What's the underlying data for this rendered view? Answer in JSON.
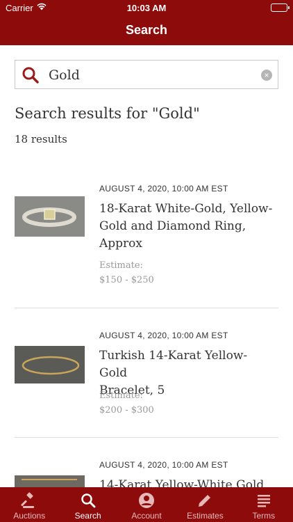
{
  "status_bar": {
    "carrier": "Carrier",
    "time": "10:03 AM"
  },
  "nav": {
    "title": "Search"
  },
  "search": {
    "value": "Gold",
    "clear_icon": "×"
  },
  "results": {
    "heading": "Search results for \"Gold\"",
    "count": "18 results",
    "items": [
      {
        "date": "AUGUST 4, 2020, 10:00 AM EST",
        "title_lines": [
          "18-Karat White-Gold, Yellow-",
          "Gold and Diamond Ring,",
          "Approx"
        ],
        "estimate_label": "Estimate:",
        "estimate_value": "$150 - $250"
      },
      {
        "date": "AUGUST 4, 2020, 10:00 AM EST",
        "title_lines": [
          "Turkish 14-Karat Yellow-Gold",
          "Bracelet, 5"
        ],
        "estimate_label": "Estimate:",
        "estimate_value": "$200 - $300"
      },
      {
        "date": "AUGUST 4, 2020, 10:00 AM EST",
        "title_lines": [
          "14-Karat Yellow-White Gold"
        ]
      }
    ]
  },
  "tabs": [
    {
      "label": "Auctions",
      "icon": "gavel-icon",
      "active": false
    },
    {
      "label": "Search",
      "icon": "search-icon",
      "active": true
    },
    {
      "label": "Account",
      "icon": "account-icon",
      "active": false
    },
    {
      "label": "Estimates",
      "icon": "pencil-icon",
      "active": false
    },
    {
      "label": "Terms",
      "icon": "list-icon",
      "active": false
    }
  ],
  "colors": {
    "brand": "#8e0b0b",
    "accent_icon": "#9c1b1b"
  }
}
